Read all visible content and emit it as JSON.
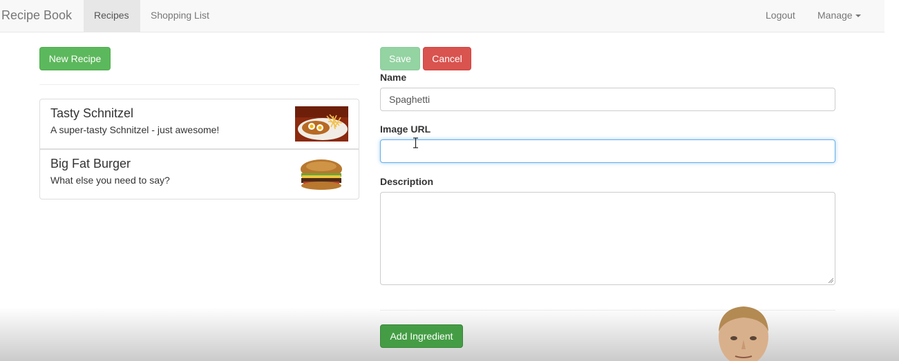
{
  "navbar": {
    "brand": "Recipe Book",
    "links": [
      {
        "label": "Recipes",
        "active": true
      },
      {
        "label": "Shopping List",
        "active": false
      }
    ],
    "right": {
      "logout": "Logout",
      "manage": "Manage"
    }
  },
  "sidebar": {
    "new_recipe_button": "New Recipe",
    "recipes": [
      {
        "name": "Tasty Schnitzel",
        "description": "A super-tasty Schnitzel - just awesome!",
        "image_icon": "schnitzel-photo"
      },
      {
        "name": "Big Fat Burger",
        "description": "What else you need to say?",
        "image_icon": "burger-photo"
      }
    ]
  },
  "form": {
    "save_button": "Save",
    "cancel_button": "Cancel",
    "name_label": "Name",
    "name_value": "Spaghetti",
    "image_url_label": "Image URL",
    "image_url_value": "",
    "description_label": "Description",
    "description_value": "",
    "add_ingredient_button": "Add Ingredient"
  },
  "colors": {
    "success": "#5cb85c",
    "success_disabled": "#8fd19e",
    "danger": "#d9534f",
    "focus": "#66afe9",
    "navbar_bg": "#f8f8f8"
  }
}
